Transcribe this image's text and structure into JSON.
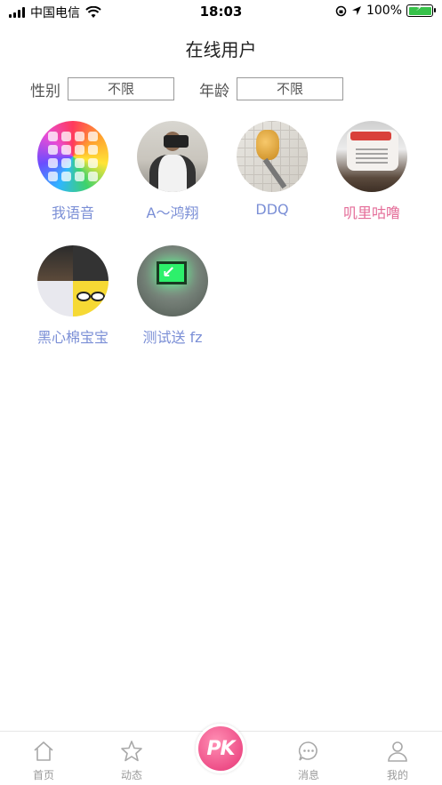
{
  "status_bar": {
    "carrier": "中国电信",
    "time": "18:03",
    "battery_percent": "100%",
    "wifi_icon": "wifi-icon",
    "lock_icon": "rotation-lock-icon",
    "location_icon": "location-arrow-icon"
  },
  "header": {
    "title": "在线用户"
  },
  "filters": {
    "gender_label": "性别",
    "gender_value": "不限",
    "age_label": "年龄",
    "age_value": "不限"
  },
  "users": [
    {
      "name": "我语音",
      "name_color": "#7b8fd6"
    },
    {
      "name": "A～鸿翔",
      "name_color": "#7b8fd6"
    },
    {
      "name": "DDQ",
      "name_color": "#7b8fd6"
    },
    {
      "name": "叽里咕噜",
      "name_color": "#e46c98"
    },
    {
      "name": "黑心棉宝宝",
      "name_color": "#7b8fd6"
    },
    {
      "name": "测试送 fz",
      "name_color": "#7b8fd6"
    }
  ],
  "tabbar": {
    "home": {
      "label": "首页",
      "icon": "home-icon"
    },
    "feed": {
      "label": "动态",
      "icon": "star-icon"
    },
    "pk": {
      "label": "PK",
      "icon": "pk-logo"
    },
    "messages": {
      "label": "消息",
      "icon": "chat-bubble-icon"
    },
    "profile": {
      "label": "我的",
      "icon": "person-icon"
    }
  },
  "colors": {
    "accent_blue": "#7b8fd6",
    "accent_pink": "#e46c98",
    "pk_pink": "#ee4f88"
  }
}
